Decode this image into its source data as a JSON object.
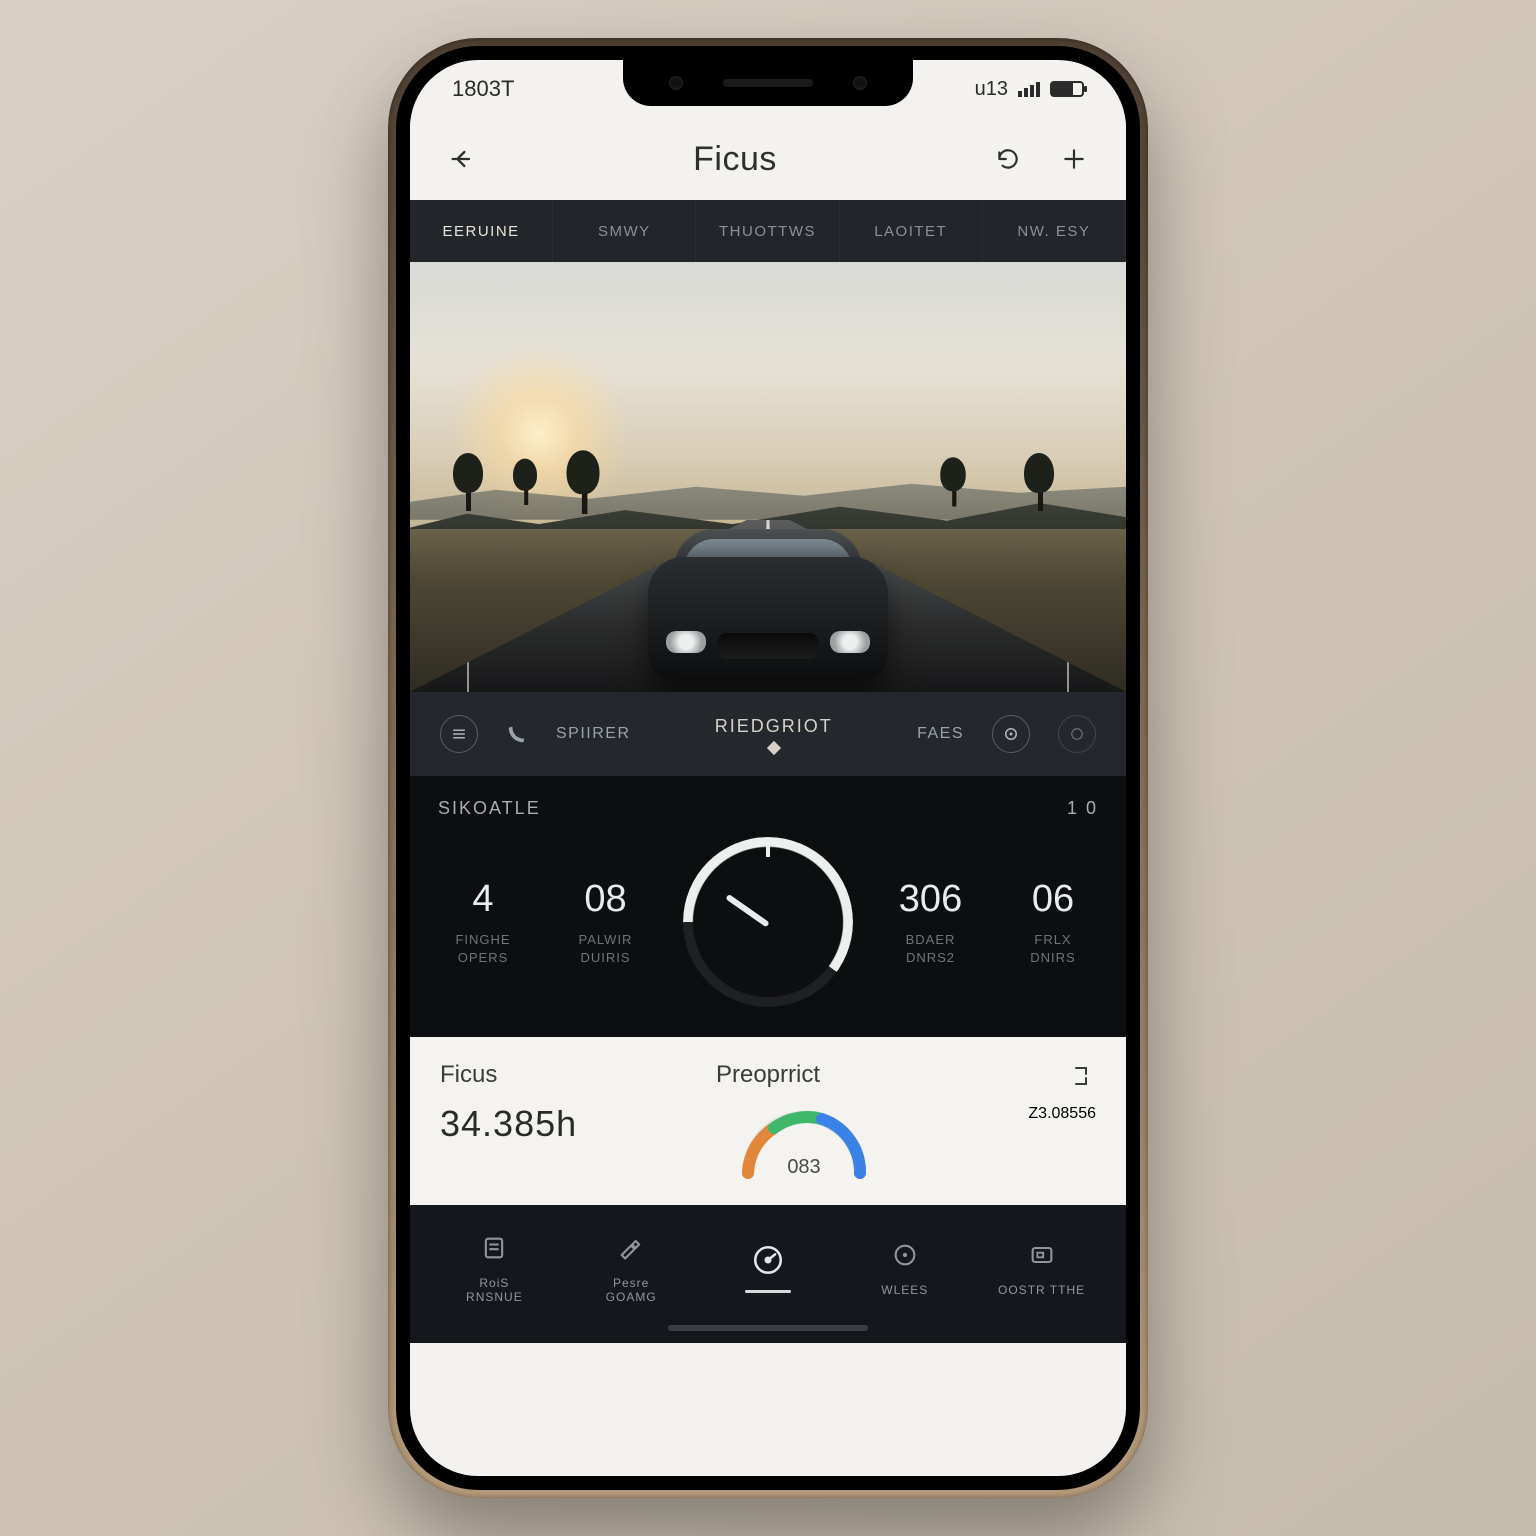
{
  "status": {
    "time": "1803T",
    "net": "u13"
  },
  "header": {
    "title": "Ficus"
  },
  "tabs": [
    {
      "label": "EERUINE",
      "active": true
    },
    {
      "label": "SMWY",
      "active": false
    },
    {
      "label": "THUOTTWS",
      "active": false
    },
    {
      "label": "LAOITET",
      "active": false
    },
    {
      "label": "NW. ESY",
      "active": false
    }
  ],
  "media": {
    "left_label": "SPIIRER",
    "center_label": "RIEDGRIOT",
    "right_label": "FAES"
  },
  "dash": {
    "top_left": "SIKOATLE",
    "top_right": "1 0",
    "stats": [
      {
        "value": "4",
        "label_a": "FINGHE",
        "label_b": "OPERS"
      },
      {
        "value": "08",
        "label_a": "PALWIR",
        "label_b": "DUIRIS"
      },
      {
        "value": "306",
        "label_a": "BDAER",
        "label_b": "DNRS2"
      },
      {
        "value": "06",
        "label_a": "FRLX",
        "label_b": "DNIRS"
      }
    ]
  },
  "summary": {
    "left_title": "Ficus",
    "left_value": "34.385h",
    "mid_title": "Preoprrict",
    "gauge_label": "083",
    "right_value": "Z3.08556"
  },
  "bnav": [
    {
      "label_a": "RoiS",
      "label_b": "RNSNUE"
    },
    {
      "label_a": "Pesre",
      "label_b": "GOAMG"
    },
    {
      "label_a": "",
      "label_b": ""
    },
    {
      "label_a": "WLEES",
      "label_b": ""
    },
    {
      "label_a": "OOSTR TTHE",
      "label_b": ""
    }
  ]
}
